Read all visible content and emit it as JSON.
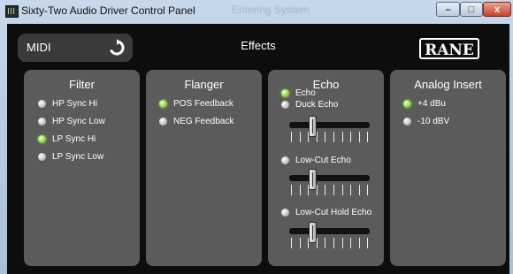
{
  "window": {
    "title": "Sixty-Two Audio Driver Control Panel",
    "ghost_title": "Entering System"
  },
  "window_controls": {
    "minimize": "–",
    "maximize": "□",
    "close": "x"
  },
  "header": {
    "midi_label": "MIDI",
    "page_title": "Effects",
    "brand": "RANE"
  },
  "filter": {
    "title": "Filter",
    "options": [
      {
        "label": "HP Sync Hi",
        "selected": false
      },
      {
        "label": "HP Sync Low",
        "selected": false
      },
      {
        "label": "LP Sync Hi",
        "selected": true
      },
      {
        "label": "LP Sync Low",
        "selected": false
      }
    ]
  },
  "flanger": {
    "title": "Flanger",
    "options": [
      {
        "label": "POS Feedback",
        "selected": true
      },
      {
        "label": "NEG Feedback",
        "selected": false
      }
    ]
  },
  "echo": {
    "title": "Echo",
    "options": [
      {
        "label": "Echo",
        "selected": true
      },
      {
        "label": "Duck Echo",
        "selected": false
      },
      {
        "label": "Low-Cut Echo",
        "selected": false
      },
      {
        "label": "Low-Cut Hold Echo",
        "selected": false
      }
    ],
    "slider_levels": [
      0.25,
      0.25,
      0.25
    ]
  },
  "analog_insert": {
    "title": "Analog Insert",
    "options": [
      {
        "label": "+4 dBu",
        "selected": true
      },
      {
        "label": "-10 dBV",
        "selected": false
      }
    ]
  },
  "colors": {
    "panel_bg": "#5b5b5b",
    "client_bg": "#0d0d0d",
    "selected_led": "#7bd23e"
  },
  "icons": {
    "midi_refresh": "refresh-icon",
    "app": "app-icon"
  }
}
